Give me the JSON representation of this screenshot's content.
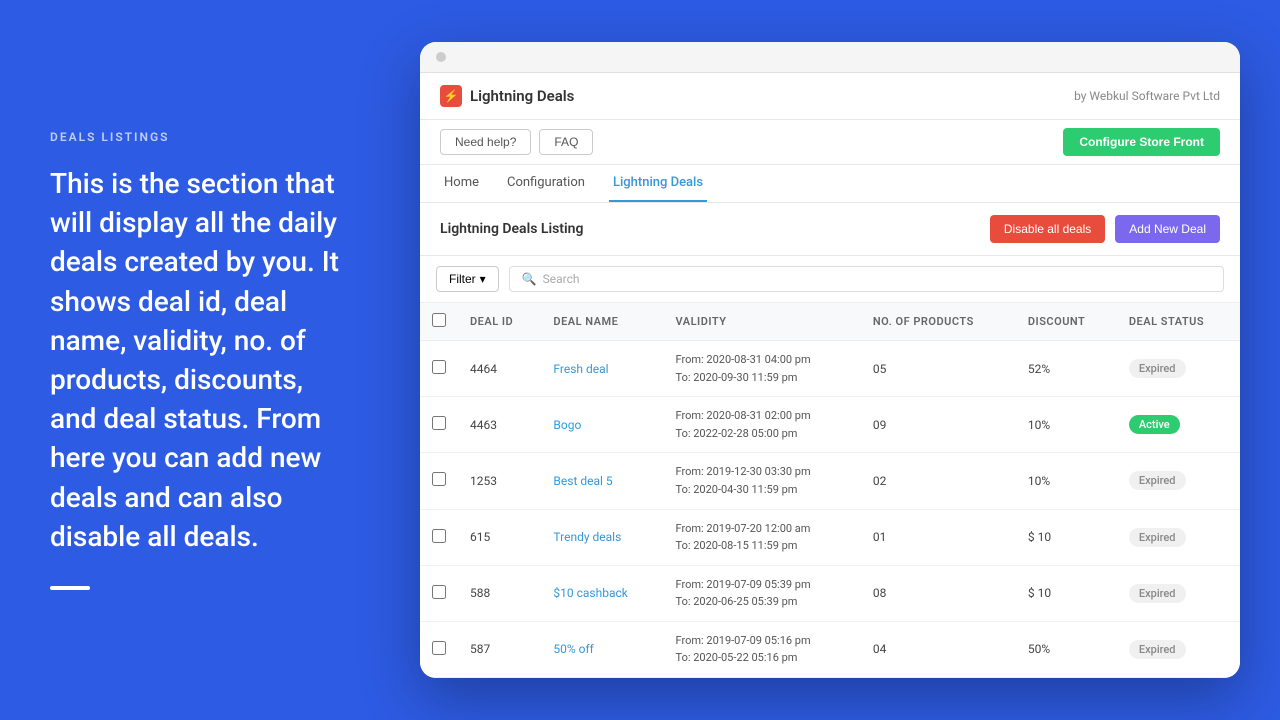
{
  "left": {
    "section_label": "DEALS LISTINGS",
    "description": "This is the section that will display all the daily deals created by you. It shows deal id, deal name, validity, no. of products, discounts, and deal status. From here you can add new deals and can also disable all deals."
  },
  "app": {
    "logo_icon": "⚡",
    "title": "Lightning Deals",
    "by_text": "by Webkul Software Pvt Ltd",
    "btn_help": "Need help?",
    "btn_faq": "FAQ",
    "btn_configure": "Configure Store Front",
    "nav": [
      {
        "label": "Home",
        "active": false
      },
      {
        "label": "Configuration",
        "active": false
      },
      {
        "label": "Lightning Deals",
        "active": true
      }
    ],
    "listing_title": "Lightning Deals Listing",
    "btn_disable_all": "Disable all deals",
    "btn_add_new": "Add New Deal",
    "filter_label": "Filter",
    "search_placeholder": "Search",
    "table": {
      "columns": [
        "DEAL ID",
        "DEAL NAME",
        "VALIDITY",
        "NO. OF PRODUCTS",
        "DISCOUNT",
        "DEAL STATUS"
      ],
      "rows": [
        {
          "id": "4464",
          "name": "Fresh deal",
          "from": "From: 2020-08-31 04:00 pm",
          "to": "To: 2020-09-30 11:59 pm",
          "products": "05",
          "discount": "52%",
          "status": "Expired",
          "status_type": "expired"
        },
        {
          "id": "4463",
          "name": "Bogo",
          "from": "From: 2020-08-31 02:00 pm",
          "to": "To: 2022-02-28 05:00 pm",
          "products": "09",
          "discount": "10%",
          "status": "Active",
          "status_type": "active"
        },
        {
          "id": "1253",
          "name": "Best deal 5",
          "from": "From: 2019-12-30 03:30 pm",
          "to": "To: 2020-04-30 11:59 pm",
          "products": "02",
          "discount": "10%",
          "status": "Expired",
          "status_type": "expired"
        },
        {
          "id": "615",
          "name": "Trendy deals",
          "from": "From: 2019-07-20 12:00 am",
          "to": "To: 2020-08-15 11:59 pm",
          "products": "01",
          "discount": "$ 10",
          "status": "Expired",
          "status_type": "expired"
        },
        {
          "id": "588",
          "name": "$10 cashback",
          "from": "From: 2019-07-09 05:39 pm",
          "to": "To: 2020-06-25 05:39 pm",
          "products": "08",
          "discount": "$ 10",
          "status": "Expired",
          "status_type": "expired"
        },
        {
          "id": "587",
          "name": "50% off",
          "from": "From: 2019-07-09 05:16 pm",
          "to": "To: 2020-05-22 05:16 pm",
          "products": "04",
          "discount": "50%",
          "status": "Expired",
          "status_type": "expired"
        }
      ]
    }
  }
}
